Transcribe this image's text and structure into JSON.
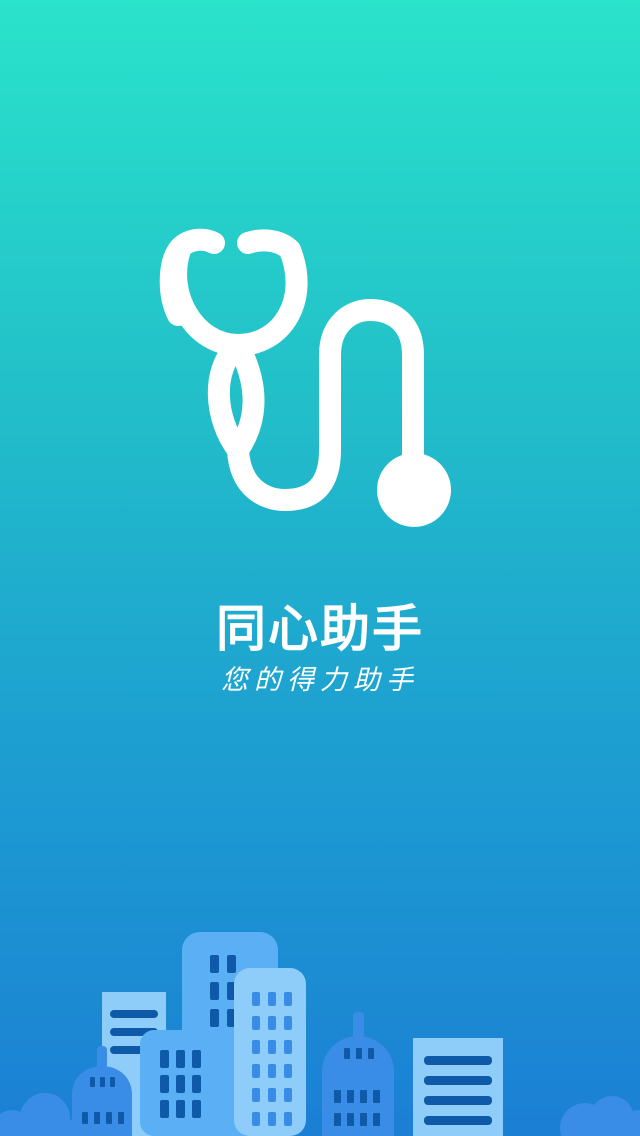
{
  "splash": {
    "title": "同心助手",
    "subtitle": "您的得力助手",
    "logo_icon": "stethoscope-icon",
    "illustration": "city-skyline-illustration"
  },
  "colors": {
    "gradient_top": "#2ae3cb",
    "gradient_bottom": "#1b7fd4",
    "text": "#ffffff",
    "logo": "#ffffff",
    "building_light": "#8ecdfa",
    "building_mid": "#5bb0f5",
    "building_dark": "#3a8de6",
    "window_dark": "#0f5aa8"
  }
}
